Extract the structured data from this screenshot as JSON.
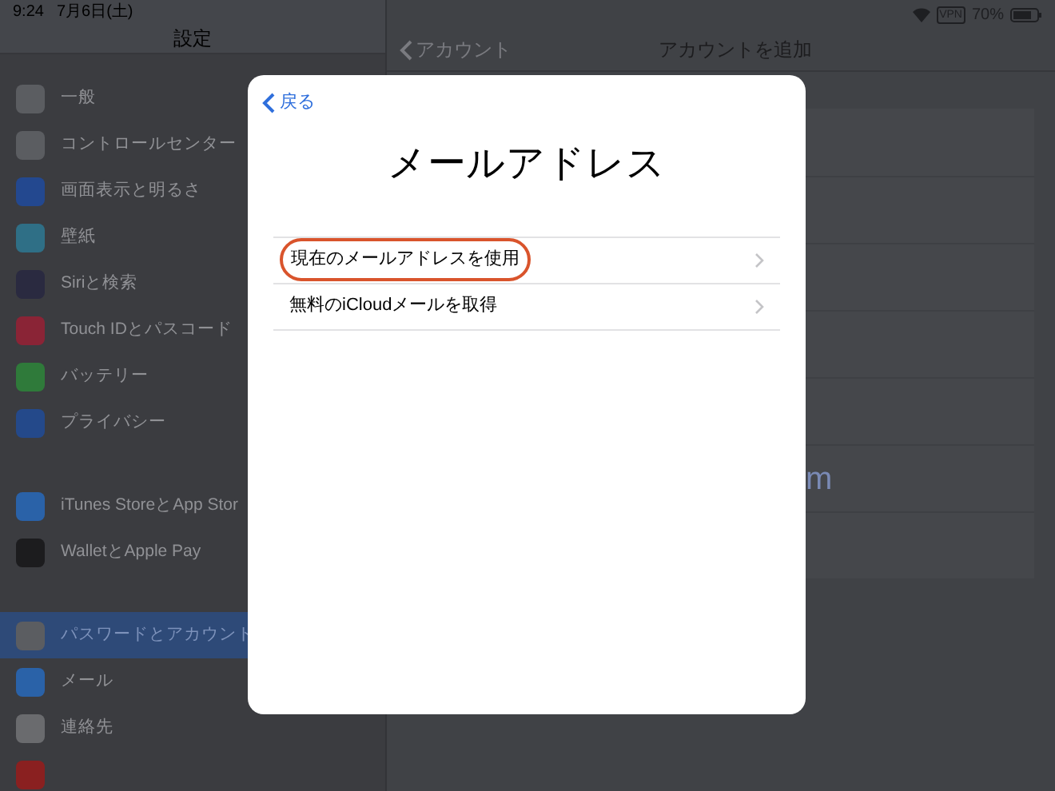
{
  "status_bar": {
    "time": "9:24",
    "date": "7月6日(土)",
    "vpn": "VPN",
    "battery": "70%"
  },
  "sidebar": {
    "title": "設定",
    "groups": [
      [
        {
          "label": "一般",
          "color": "#5b5d61",
          "selected": false
        },
        {
          "label": "コントロールセンター",
          "color": "#5b5d61",
          "selected": false
        },
        {
          "label": "画面表示と明るさ",
          "color": "#23488f",
          "selected": false
        },
        {
          "label": "壁紙",
          "color": "#2f6f86",
          "selected": false
        },
        {
          "label": "Siriと検索",
          "color": "#2a2a40",
          "selected": false
        },
        {
          "label": "Touch IDとパスコード",
          "color": "#8a2436",
          "selected": false
        },
        {
          "label": "バッテリー",
          "color": "#2f7a3a",
          "selected": false
        },
        {
          "label": "プライバシー",
          "color": "#24498a",
          "selected": false
        }
      ],
      [
        {
          "label": "iTunes StoreとApp Stor",
          "color": "#2a62a8",
          "selected": false
        },
        {
          "label": "WalletとApple Pay",
          "color": "#1c1c1e",
          "selected": false
        }
      ],
      [
        {
          "label": "パスワードとアカウント",
          "color": "#5b5d61",
          "selected": true
        },
        {
          "label": "メール",
          "color": "#2a62a8",
          "selected": false
        },
        {
          "label": "連絡先",
          "color": "#6a6b6e",
          "selected": false
        },
        {
          "color": "#8a2020",
          "selected": false
        }
      ]
    ]
  },
  "detail": {
    "back": "アカウント",
    "title": "アカウントを追加",
    "rows": [
      {},
      {},
      {},
      {},
      {},
      {
        "text": "m"
      },
      {}
    ]
  },
  "modal": {
    "back": "戻る",
    "title": "メールアドレス",
    "options": [
      {
        "label": "現在のメールアドレスを使用",
        "highlighted": true
      },
      {
        "label": "無料のiCloudメールを取得",
        "highlighted": false
      }
    ]
  }
}
